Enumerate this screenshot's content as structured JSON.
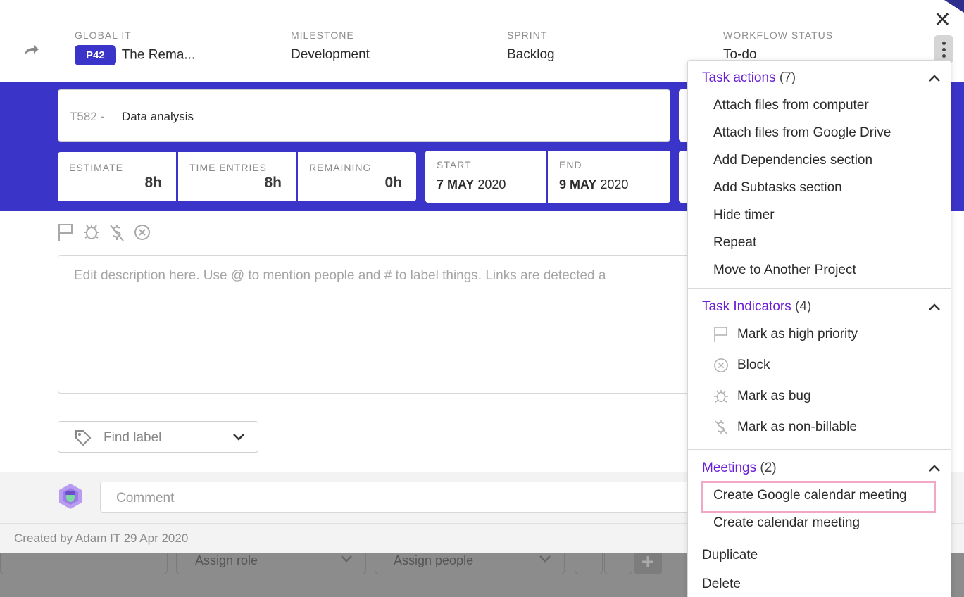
{
  "header": {
    "project_label": "GLOBAL IT",
    "project_badge": "P42",
    "project_name": "The Rema...",
    "milestone_label": "MILESTONE",
    "milestone_value": "Development",
    "sprint_label": "SPRINT",
    "sprint_value": "Backlog",
    "workflow_label": "WORKFLOW STATUS",
    "workflow_value": "To-do",
    "close_label": "✕"
  },
  "task": {
    "id": "T582 -",
    "title": "Data analysis"
  },
  "stats": {
    "estimate_label": "ESTIMATE",
    "estimate_value": "8h",
    "time_entries_label": "TIME ENTRIES",
    "time_entries_value": "8h",
    "remaining_label": "REMAINING",
    "remaining_value": "0h",
    "start_label": "START",
    "start_day": "7 MAY",
    "start_year": " 2020",
    "end_label": "END",
    "end_day": "9 MAY",
    "end_year": " 2020"
  },
  "description": {
    "placeholder": "Edit description here. Use @ to mention people and # to label things. Links are detected a"
  },
  "labels": {
    "placeholder": "Find label"
  },
  "comment": {
    "placeholder": "Comment"
  },
  "footer": {
    "created": "Created by Adam IT 29 Apr 2020",
    "assign_role": "Assign role",
    "assign_people": "Assign people"
  },
  "menu": {
    "task_actions": {
      "title": "Task actions",
      "count": "(7)",
      "items": [
        "Attach files from computer",
        "Attach files from Google Drive",
        "Add Dependencies section",
        "Add Subtasks section",
        "Hide timer",
        "Repeat",
        "Move to Another Project"
      ]
    },
    "task_indicators": {
      "title": "Task Indicators",
      "count": "(4)",
      "items": [
        {
          "label": "Mark as high priority",
          "icon": "flag-icon"
        },
        {
          "label": "Block",
          "icon": "block-icon"
        },
        {
          "label": "Mark as bug",
          "icon": "bug-icon"
        },
        {
          "label": "Mark as non-billable",
          "icon": "non-billable-icon"
        }
      ]
    },
    "meetings": {
      "title": "Meetings",
      "count": "(2)",
      "items": [
        "Create Google calendar meeting",
        "Create calendar meeting"
      ]
    },
    "duplicate": "Duplicate",
    "delete": "Delete"
  },
  "colors": {
    "brand": "#3b34c8",
    "section_heading": "#6a1ed6",
    "highlight": "#f2a7c6"
  }
}
